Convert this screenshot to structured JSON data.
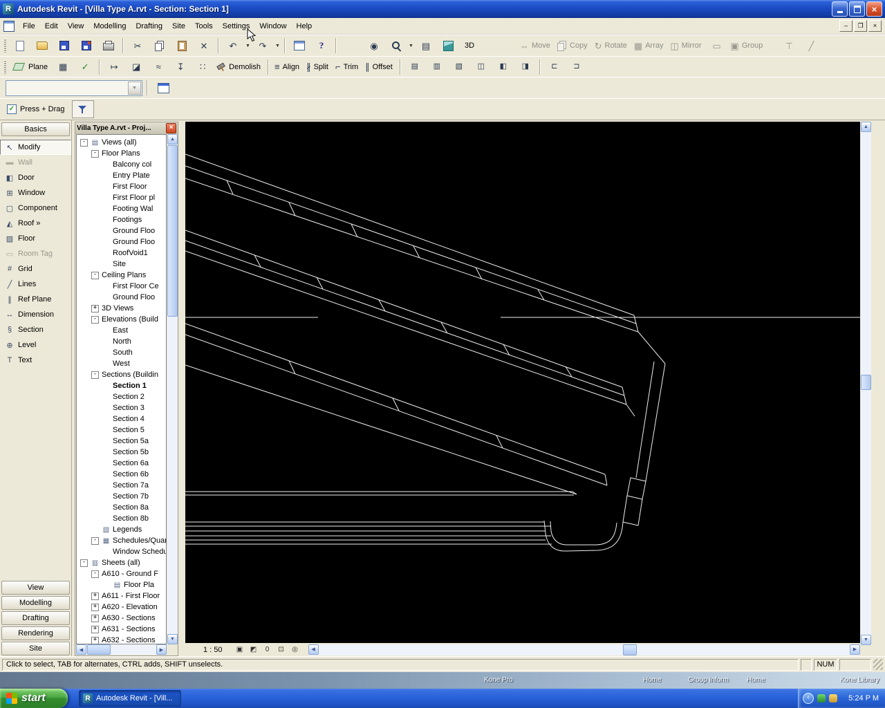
{
  "window": {
    "title": "Autodesk Revit - [Villa Type A.rvt - Section: Section 1]"
  },
  "menu": {
    "items": [
      "File",
      "Edit",
      "View",
      "Modelling",
      "Drafting",
      "Site",
      "Tools",
      "Settings",
      "Window",
      "Help"
    ]
  },
  "toolbars": {
    "plane": "Plane",
    "demolish": "Demolish",
    "align": "Align",
    "split": "Split",
    "trim": "Trim",
    "offset": "Offset",
    "threeD": "3D",
    "move": "Move",
    "copy": "Copy",
    "rotate": "Rotate",
    "array": "Array",
    "mirror": "Mirror",
    "group": "Group"
  },
  "type_selector": {
    "value": ""
  },
  "options": {
    "press_drag": "Press + Drag"
  },
  "design_bar": {
    "header": "Basics",
    "items": [
      {
        "label": "Modify",
        "icon": "modify",
        "state": "selected"
      },
      {
        "label": "Wall",
        "icon": "wall",
        "state": "disabled"
      },
      {
        "label": "Door",
        "icon": "door"
      },
      {
        "label": "Window",
        "icon": "window"
      },
      {
        "label": "Component",
        "icon": "component"
      },
      {
        "label": "Roof »",
        "icon": "roof"
      },
      {
        "label": "Floor",
        "icon": "floor"
      },
      {
        "label": "Room Tag",
        "icon": "roomtag",
        "state": "disabled"
      },
      {
        "label": "Grid",
        "icon": "grid"
      },
      {
        "label": "Lines",
        "icon": "lines"
      },
      {
        "label": "Ref Plane",
        "icon": "refplane"
      },
      {
        "label": "Dimension",
        "icon": "dimension"
      },
      {
        "label": "Section",
        "icon": "section"
      },
      {
        "label": "Level",
        "icon": "level"
      },
      {
        "label": "Text",
        "icon": "text"
      }
    ],
    "tabs": [
      "View",
      "Modelling",
      "Drafting",
      "Rendering",
      "Site"
    ]
  },
  "browser": {
    "title": "Villa Type A.rvt - Proj...",
    "tree": [
      {
        "label": "Views (all)",
        "depth": 0,
        "exp": "minus",
        "icon": "views"
      },
      {
        "label": "Floor Plans",
        "depth": 1,
        "exp": "minus"
      },
      {
        "label": "Balcony col",
        "depth": 2
      },
      {
        "label": "Entry Plate",
        "depth": 2
      },
      {
        "label": "First Floor",
        "depth": 2
      },
      {
        "label": "First Floor pl",
        "depth": 2
      },
      {
        "label": "Footing Wal",
        "depth": 2
      },
      {
        "label": "Footings",
        "depth": 2
      },
      {
        "label": "Ground Floo",
        "depth": 2
      },
      {
        "label": "Ground Floo",
        "depth": 2
      },
      {
        "label": "RoofVoid1",
        "depth": 2
      },
      {
        "label": "Site",
        "depth": 2
      },
      {
        "label": "Ceiling Plans",
        "depth": 1,
        "exp": "minus"
      },
      {
        "label": "First Floor Ce",
        "depth": 2
      },
      {
        "label": "Ground Floo",
        "depth": 2
      },
      {
        "label": "3D Views",
        "depth": 1,
        "exp": "plus"
      },
      {
        "label": "Elevations (Build",
        "depth": 1,
        "exp": "minus"
      },
      {
        "label": "East",
        "depth": 2
      },
      {
        "label": "North",
        "depth": 2
      },
      {
        "label": "South",
        "depth": 2
      },
      {
        "label": "West",
        "depth": 2
      },
      {
        "label": "Sections (Buildin",
        "depth": 1,
        "exp": "minus"
      },
      {
        "label": "Section 1",
        "depth": 2,
        "bold": true
      },
      {
        "label": "Section 2",
        "depth": 2
      },
      {
        "label": "Section 3",
        "depth": 2
      },
      {
        "label": "Section 4",
        "depth": 2
      },
      {
        "label": "Section 5",
        "depth": 2
      },
      {
        "label": "Section 5a",
        "depth": 2
      },
      {
        "label": "Section 5b",
        "depth": 2
      },
      {
        "label": "Section 6a",
        "depth": 2
      },
      {
        "label": "Section 6b",
        "depth": 2
      },
      {
        "label": "Section 7a",
        "depth": 2
      },
      {
        "label": "Section 7b",
        "depth": 2
      },
      {
        "label": "Section 8a",
        "depth": 2
      },
      {
        "label": "Section 8b",
        "depth": 2
      },
      {
        "label": "Legends",
        "depth": 1,
        "icon": "legend"
      },
      {
        "label": "Schedules/Quan",
        "depth": 1,
        "exp": "minus",
        "icon": "schedule"
      },
      {
        "label": "Window Schedu",
        "depth": 2
      },
      {
        "label": "Sheets (all)",
        "depth": 0,
        "exp": "minus",
        "icon": "sheets"
      },
      {
        "label": "A610 - Ground F",
        "depth": 1,
        "exp": "minus"
      },
      {
        "label": "Floor Pla",
        "depth": 2,
        "icon": "sheet"
      },
      {
        "label": "A611 - First Floor",
        "depth": 1,
        "exp": "plus"
      },
      {
        "label": "A620 - Elevation",
        "depth": 1,
        "exp": "plus"
      },
      {
        "label": "A630 - Sections",
        "depth": 1,
        "exp": "plus"
      },
      {
        "label": "A631 - Sections",
        "depth": 1,
        "exp": "plus"
      },
      {
        "label": "A632 - Sections",
        "depth": 1,
        "exp": "plus"
      }
    ]
  },
  "view_bar": {
    "scale": "1 : 50"
  },
  "status": {
    "message": "Click to select, TAB for alternates, CTRL adds, SHIFT unselects.",
    "num": "NUM"
  },
  "desktop": {
    "labels": [
      "Kone Pro",
      "Home",
      "Group Inform",
      "Home",
      "Kone Library"
    ]
  },
  "taskbar": {
    "start": "start",
    "task": "Autodesk Revit - [Vill...",
    "time": "5:24 P M"
  }
}
